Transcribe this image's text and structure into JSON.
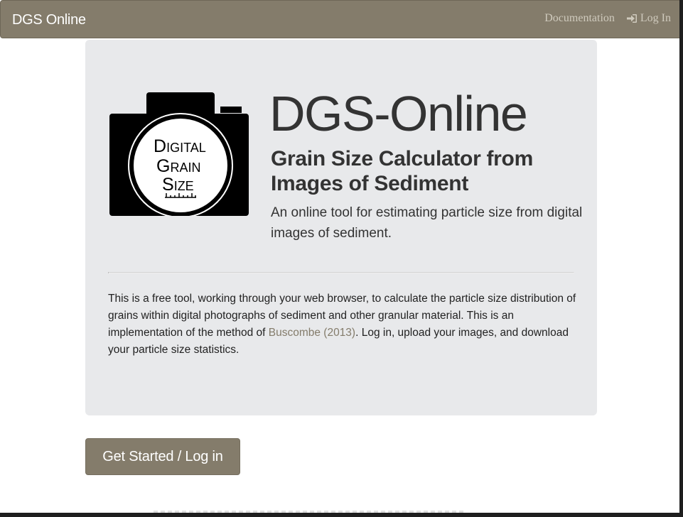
{
  "navbar": {
    "brand": "DGS Online",
    "links": {
      "documentation": "Documentation",
      "login": "Log In",
      "login_icon": "sign-in-icon"
    }
  },
  "hero": {
    "logo": {
      "icon": "camera-logo",
      "line1_cap": "D",
      "line1_rest": "IGITAL",
      "line2_cap": "G",
      "line2_rest": "RAIN",
      "line3_cap": "S",
      "line3_rest": "IZE"
    },
    "title": "DGS-Online",
    "subtitle": "Grain Size Calculator from Images of Sediment",
    "lead": "An online tool for estimating particle size from digital images of sediment.",
    "description": {
      "before_link": "This is a free tool, working through your web browser, to calculate the particle size distribution of grains within digital photographs of sediment and other granular material. This is an implementation of the method of ",
      "link_text": "Buscombe (2013)",
      "after_link": ". Log in, upload your images, and download your particle size statistics."
    }
  },
  "cta": {
    "label": "Get Started / Log in"
  },
  "colors": {
    "navbar": "#847c6b",
    "jumbotron": "#e8e9eb",
    "link": "#847c6b",
    "button": "#847c6b"
  }
}
